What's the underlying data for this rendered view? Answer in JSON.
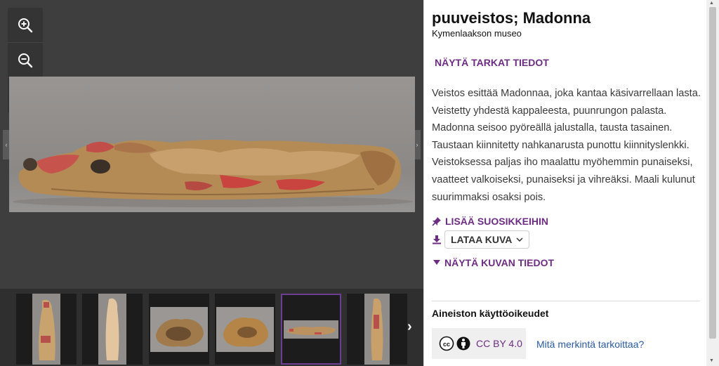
{
  "viewer": {
    "zoom_controls": [
      {
        "name": "zoom-in-icon"
      },
      {
        "name": "zoom-out-icon"
      },
      {
        "name": "fit-screen-icon"
      }
    ],
    "prev_arrow": "‹",
    "next_arrow": "›",
    "thumbnails": [
      {
        "name": "thumbnail-1",
        "selected": false
      },
      {
        "name": "thumbnail-2",
        "selected": false
      },
      {
        "name": "thumbnail-3",
        "selected": false
      },
      {
        "name": "thumbnail-4",
        "selected": false
      },
      {
        "name": "thumbnail-5",
        "selected": true
      },
      {
        "name": "thumbnail-6",
        "selected": false
      }
    ],
    "strip_next": "›"
  },
  "record": {
    "title": "puuveistos; Madonna",
    "museum": "Kymenlaakson museo",
    "details_link": "NÄYTÄ TARKAT TIEDOT",
    "description": "Veistos esittää Madonnaa, joka kantaa käsivarrellaan lasta. Veistetty yhdestä kappaleesta, puunrungon palasta. Madonna seisoo pyöreällä jalustalla, tausta tasainen. Taustaan kiinnitetty nahkanarusta punottu kiinnityslenkki. Veistoksessa paljas iho maalattu myöhemmin punaiseksi, vaatteet valkoiseksi, punaiseksi ja vihreäksi. Maali kulunut suurimmaksi osaksi pois.",
    "favorite_label": "LISÄÄ SUOSIKKEIHIN",
    "download_label": "LATAA KUVA",
    "image_info_label": "NÄYTÄ KUVAN TIEDOT"
  },
  "rights": {
    "title": "Aineiston käyttöoikeudet",
    "license": "CC BY 4.0",
    "meaning_link": "Mitä merkintä tarkoittaa?"
  },
  "colors": {
    "accent": "#6c2d82",
    "link": "#2a5aa0",
    "viewer_bg": "#3e3e3e",
    "thumb_selected": "#6c3d91"
  }
}
